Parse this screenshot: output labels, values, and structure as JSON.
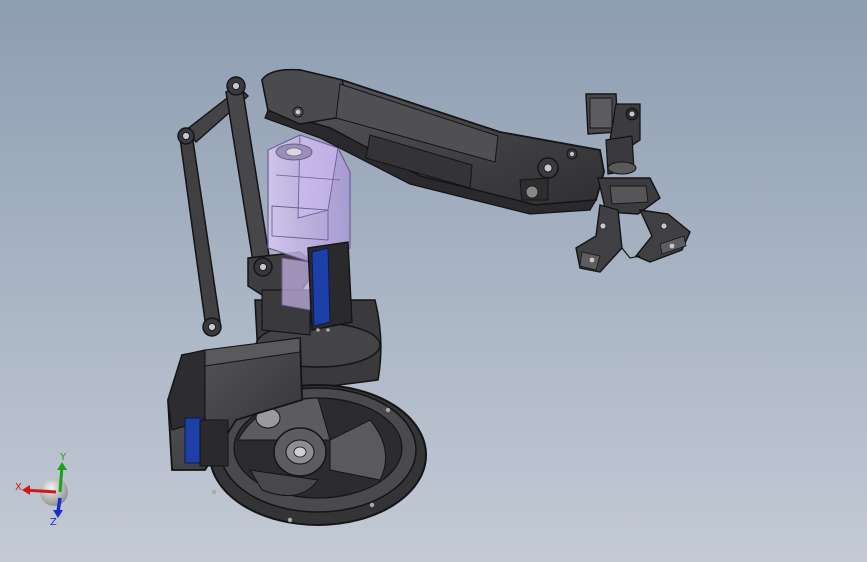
{
  "scene": {
    "model": "robot-arm-assembly",
    "colors": {
      "body": "#3d3d3f",
      "body_dark": "#2a2a2c",
      "body_light": "#5a5a5d",
      "edge": "#141416",
      "glass": "#c9b6ea",
      "glass_edge": "#7a6aa0",
      "motor_blue": "#1d3fa8",
      "metal": "#b8b8bc"
    }
  },
  "triad": {
    "x_label": "X",
    "y_label": "Y",
    "z_label": "Z",
    "x_color": "#d01818",
    "y_color": "#1aa31a",
    "z_color": "#1a2ecc"
  }
}
